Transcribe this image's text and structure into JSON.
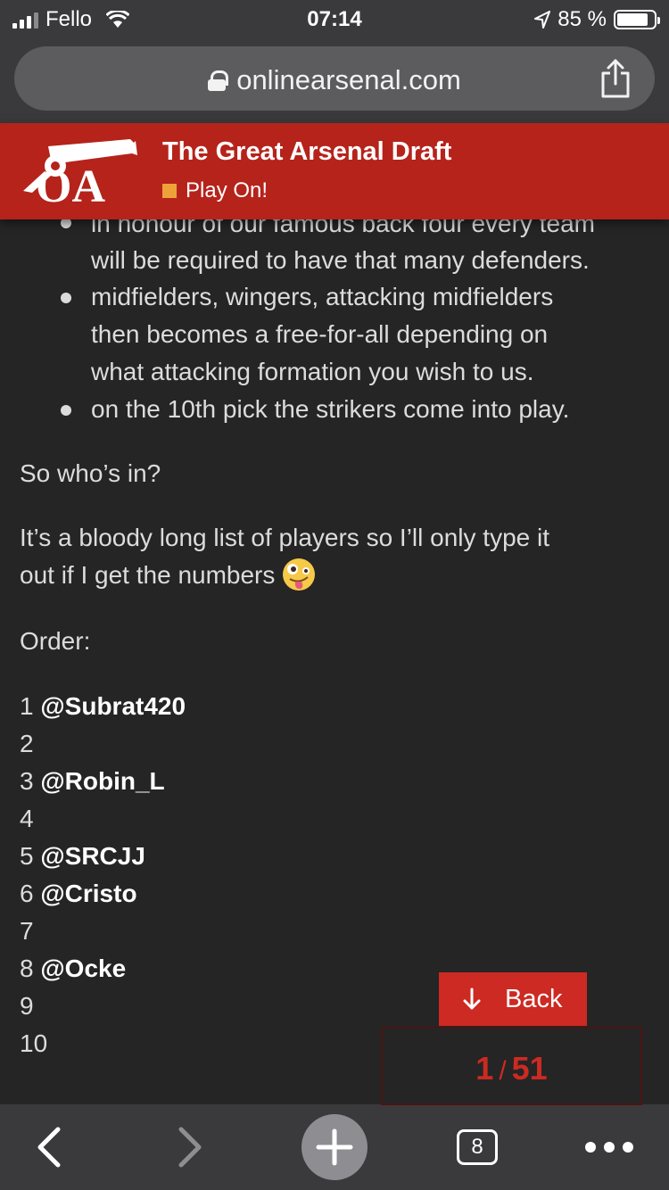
{
  "status_bar": {
    "carrier": "Fello",
    "time": "07:14",
    "battery": "85 %",
    "battery_level": 0.85
  },
  "browser": {
    "url": "onlinearsenal.com",
    "tab_count": "8"
  },
  "site": {
    "logo_text": "OA",
    "title": "The Great Arsenal Draft",
    "subtitle": "Play On!"
  },
  "post": {
    "bullets": [
      "in honour of our famous back four every team",
      "will be required to have that many defenders.",
      "midfielders, wingers, attacking midfielders",
      "then becomes a free-for-all depending on",
      "what attacking formation you wish to us.",
      "on the 10th pick the strikers come into play."
    ],
    "question": "So who’s in?",
    "para_line1": "It’s a bloody long list of players so I’ll only type it",
    "para_line2": "out if I get the numbers",
    "order_label": "Order:",
    "order": [
      {
        "num": "1",
        "user": "@Subrat420"
      },
      {
        "num": "2",
        "user": ""
      },
      {
        "num": "3",
        "user": "@Robin_L"
      },
      {
        "num": "4",
        "user": ""
      },
      {
        "num": "5",
        "user": "@SRCJJ"
      },
      {
        "num": "6",
        "user": "@Cristo"
      },
      {
        "num": "7",
        "user": ""
      },
      {
        "num": "8",
        "user": "@Ocke"
      },
      {
        "num": "9",
        "user": ""
      },
      {
        "num": "10",
        "user": ""
      }
    ]
  },
  "nav": {
    "back_label": "Back",
    "page_current": "1",
    "page_sep": "/",
    "page_total": "51"
  },
  "colors": {
    "header_red": "#b5231b",
    "accent_red": "#cc2a22",
    "orange": "#f0a23a",
    "background": "#252525"
  }
}
